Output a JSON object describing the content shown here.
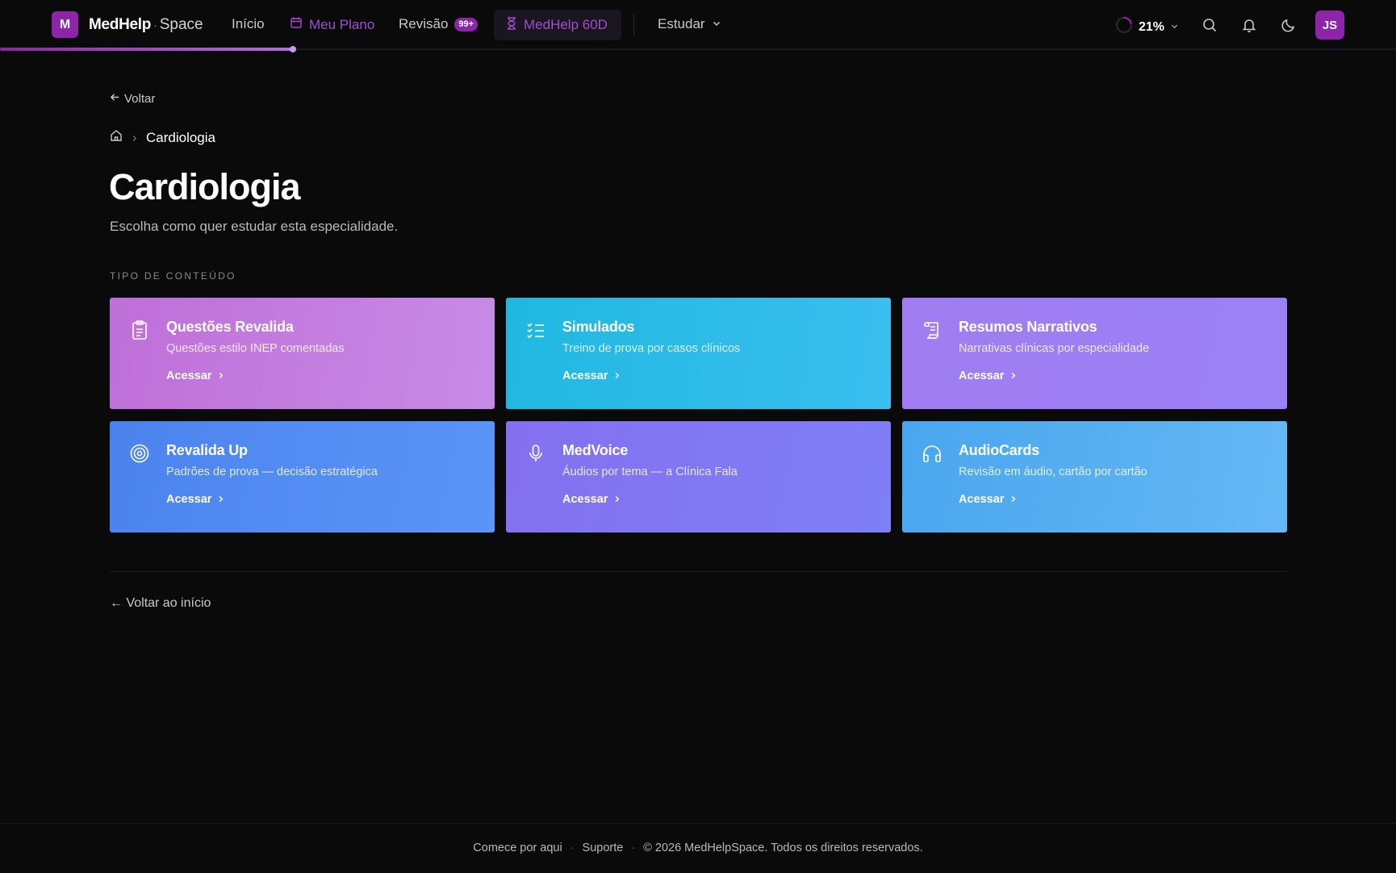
{
  "header": {
    "logo_letter": "M",
    "brand_bold": "MedHelp",
    "brand_dot": "·",
    "brand_light": "Space",
    "nav": {
      "inicio": "Início",
      "meu_plano": "Meu Plano",
      "revisao": "Revisão",
      "revisao_badge": "99+",
      "medhelp60d": "MedHelp 60D",
      "estudar": "Estudar"
    },
    "progress_label": "21%",
    "progress_value": 0.21,
    "avatar_initials": "JS",
    "accent_color": "#8e24aa"
  },
  "page": {
    "back_label": "Voltar",
    "breadcrumb_current": "Cardiologia",
    "title": "Cardiologia",
    "subtitle": "Escolha como quer estudar esta especialidade.",
    "section_label": "TIPO DE CONTEÚDO",
    "back_home_label": "← Voltar ao início"
  },
  "cards": [
    {
      "title": "Questões Revalida",
      "desc": "Questões estilo INEP comentadas",
      "link": "Acessar",
      "icon": "clipboard-icon",
      "gradient": [
        "#bf6fd8",
        "#c78be6"
      ]
    },
    {
      "title": "Simulados",
      "desc": "Treino de prova por casos clínicos",
      "link": "Acessar",
      "icon": "list-checks-icon",
      "gradient": [
        "#1fb8e0",
        "#3bbff0"
      ]
    },
    {
      "title": "Resumos Narrativos",
      "desc": "Narrativas clínicas por especialidade",
      "link": "Acessar",
      "icon": "scroll-icon",
      "gradient": [
        "#a07df0",
        "#9b80f6"
      ]
    },
    {
      "title": "Revalida Up",
      "desc": "Padrões de prova — decisão estratégica",
      "link": "Acessar",
      "icon": "target-icon",
      "gradient": [
        "#4b83ee",
        "#5b95f7"
      ]
    },
    {
      "title": "MedVoice",
      "desc": "Áudios por tema — a Clínica Fala",
      "link": "Acessar",
      "icon": "microphone-icon",
      "gradient": [
        "#8470ee",
        "#7f7ff8"
      ]
    },
    {
      "title": "AudioCards",
      "desc": "Revisão em áudio, cartão por cartão",
      "link": "Acessar",
      "icon": "headphones-icon",
      "gradient": [
        "#4aa6ee",
        "#64b8f4"
      ]
    }
  ],
  "footer": {
    "link1": "Comece por aqui",
    "sep": "·",
    "link2": "Suporte",
    "copyright": "© 2026 MedHelpSpace. Todos os direitos reservados."
  }
}
